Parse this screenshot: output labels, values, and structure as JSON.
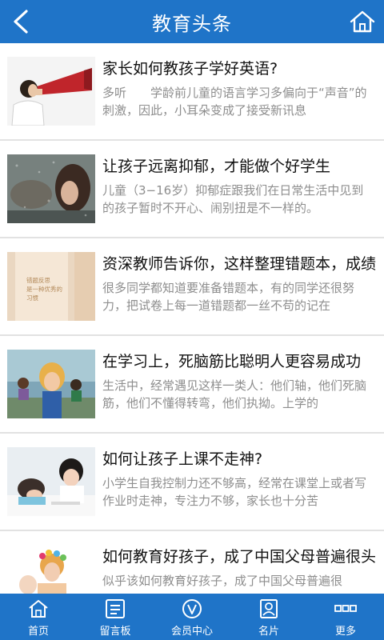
{
  "header": {
    "title": "教育头条",
    "back_icon": "back-arrow-icon",
    "home_icon": "home-icon"
  },
  "colors": {
    "primary": "#1f74c8",
    "title_text": "#111111",
    "desc_text": "#8e8e8e",
    "divider": "#e2e2e2"
  },
  "articles": [
    {
      "title": "家长如何教孩子学好英语?",
      "desc": "多听　　学龄前儿童的语言学习多偏向于“声音”的刺激，因此，小耳朵变成了接受新讯息"
    },
    {
      "title": "让孩子远离抑郁，才能做个好学生",
      "desc": "儿童（3−16岁）抑郁症跟我们在日常生活中见到的孩子暂时不开心、闹别扭是不一样的。"
    },
    {
      "title": "资深教师告诉你，这样整理错题本，成绩",
      "desc": "很多同学都知道要准备错题本，有的同学还很努力，把试卷上每一道错题都一丝不苟的记在",
      "thumb_text": [
        "错题反思",
        "是一种优秀的",
        "习惯"
      ]
    },
    {
      "title": "在学习上，死脑筋比聪明人更容易成功",
      "desc": "生活中，经常遇见这样一类人：他们轴，他们死脑筋，他们不懂得转弯，他们执拗。上学的"
    },
    {
      "title": "如何让孩子上课不走神?",
      "desc": "小学生自我控制力还不够高，经常在课堂上或者写作业时走神，专注力不够，家长也十分苦"
    },
    {
      "title": "如何教育好孩子，成了中国父母普遍很头",
      "desc": "似乎该如何教育好孩子，成了中国父母普遍很"
    }
  ],
  "tabs": [
    {
      "label": "首页",
      "icon": "home-icon"
    },
    {
      "label": "留言板",
      "icon": "message-board-icon"
    },
    {
      "label": "会员中心",
      "icon": "member-center-icon"
    },
    {
      "label": "名片",
      "icon": "business-card-icon"
    },
    {
      "label": "更多",
      "icon": "more-icon"
    }
  ]
}
